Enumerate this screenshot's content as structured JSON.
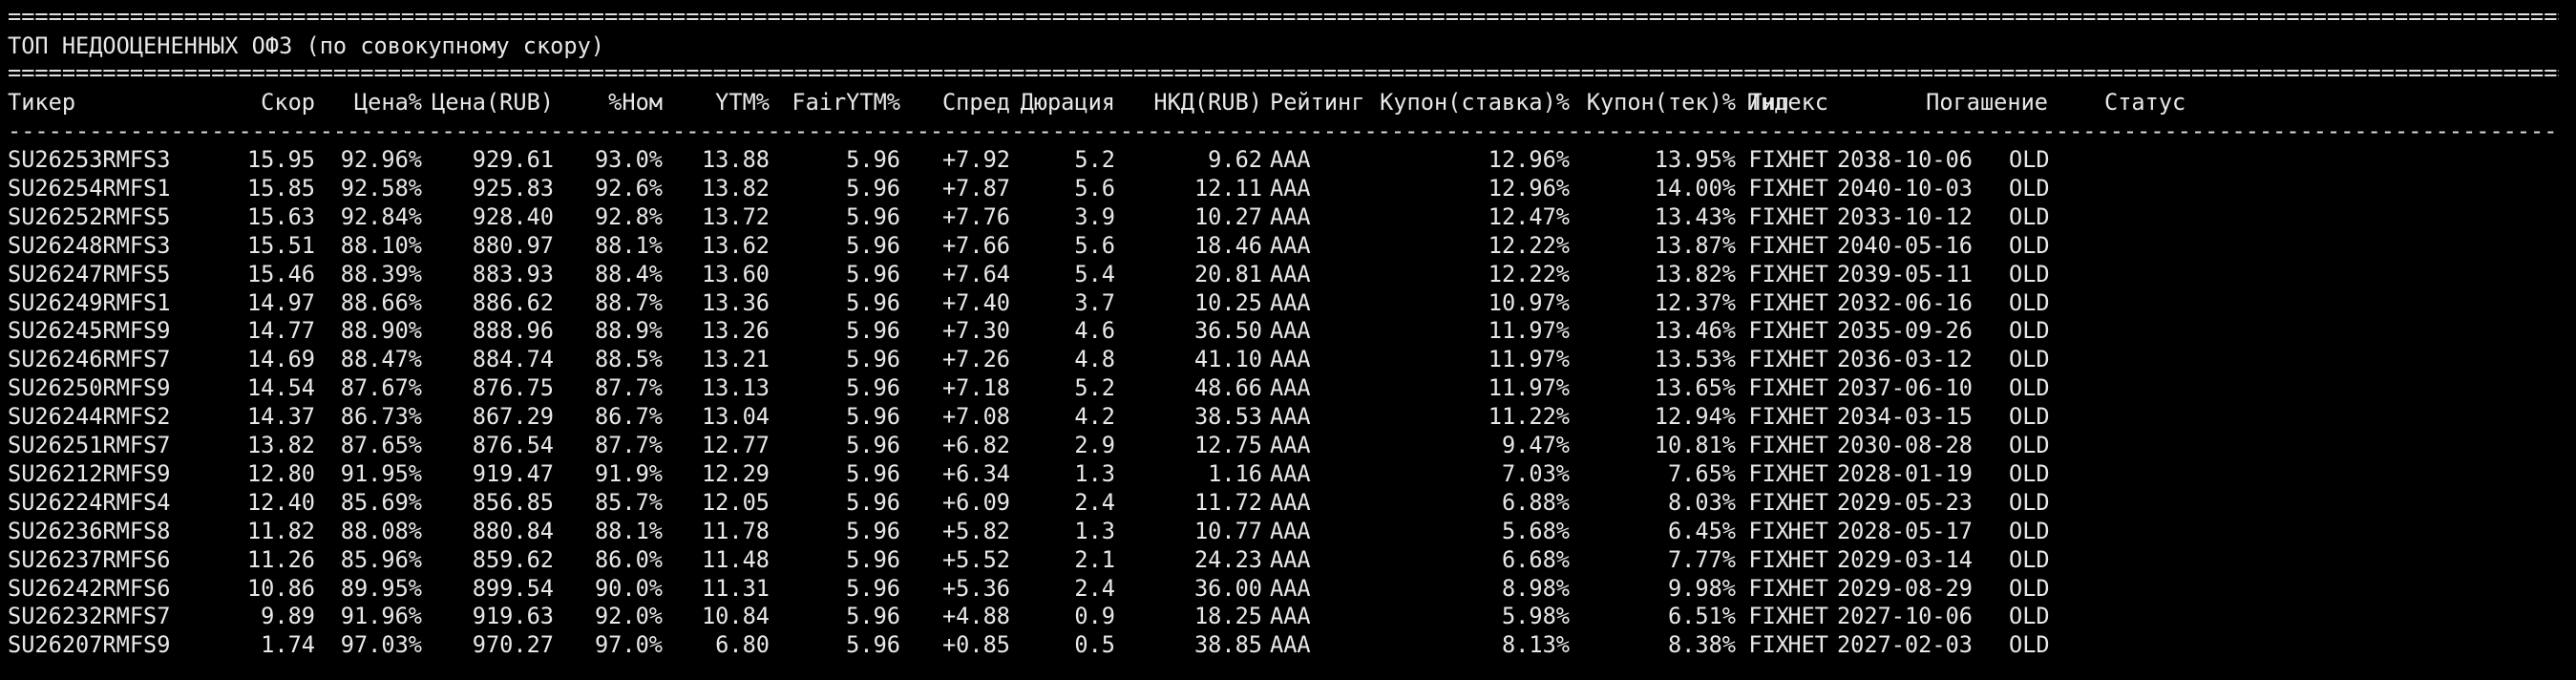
{
  "title": "ТОП НЕДООЦЕНЕННЫХ ОФЗ (по совокупному скору)",
  "rule_double_char": "=",
  "rule_single_char": "-",
  "columns": [
    {
      "key": "ticker",
      "label": "Тикер"
    },
    {
      "key": "score",
      "label": "Скор"
    },
    {
      "key": "price_pct",
      "label": "Цена%"
    },
    {
      "key": "price_rub",
      "label": "Цена(RUB)"
    },
    {
      "key": "pct_nom",
      "label": "%Ном"
    },
    {
      "key": "ytm",
      "label": "YTM%"
    },
    {
      "key": "fair_ytm",
      "label": "FairYTM%"
    },
    {
      "key": "spread",
      "label": "Спред"
    },
    {
      "key": "duration",
      "label": "Дюрация"
    },
    {
      "key": "nkd",
      "label": "НКД(RUB)"
    },
    {
      "key": "rating",
      "label": "Рейтинг"
    },
    {
      "key": "coupon_rate",
      "label": "Купон(ставка)%"
    },
    {
      "key": "coupon_cur",
      "label": "Купон(тек)%"
    },
    {
      "key": "type",
      "label": "Тип"
    },
    {
      "key": "index",
      "label": "Индекс"
    },
    {
      "key": "maturity",
      "label": "Погашение"
    },
    {
      "key": "status",
      "label": "Статус"
    }
  ],
  "rows": [
    {
      "ticker": "SU26253RMFS3",
      "score": "15.95",
      "price_pct": "92.96%",
      "price_rub": "929.61",
      "pct_nom": "93.0%",
      "ytm": "13.88",
      "fair_ytm": "5.96",
      "spread": "+7.92",
      "duration": "5.2",
      "nkd": "9.62",
      "rating": "AAA",
      "coupon_rate": "12.96%",
      "coupon_cur": "13.95%",
      "type": "FIX",
      "index": "НЕТ",
      "maturity": "2038-10-06",
      "status": "OLD"
    },
    {
      "ticker": "SU26254RMFS1",
      "score": "15.85",
      "price_pct": "92.58%",
      "price_rub": "925.83",
      "pct_nom": "92.6%",
      "ytm": "13.82",
      "fair_ytm": "5.96",
      "spread": "+7.87",
      "duration": "5.6",
      "nkd": "12.11",
      "rating": "AAA",
      "coupon_rate": "12.96%",
      "coupon_cur": "14.00%",
      "type": "FIX",
      "index": "НЕТ",
      "maturity": "2040-10-03",
      "status": "OLD"
    },
    {
      "ticker": "SU26252RMFS5",
      "score": "15.63",
      "price_pct": "92.84%",
      "price_rub": "928.40",
      "pct_nom": "92.8%",
      "ytm": "13.72",
      "fair_ytm": "5.96",
      "spread": "+7.76",
      "duration": "3.9",
      "nkd": "10.27",
      "rating": "AAA",
      "coupon_rate": "12.47%",
      "coupon_cur": "13.43%",
      "type": "FIX",
      "index": "НЕТ",
      "maturity": "2033-10-12",
      "status": "OLD"
    },
    {
      "ticker": "SU26248RMFS3",
      "score": "15.51",
      "price_pct": "88.10%",
      "price_rub": "880.97",
      "pct_nom": "88.1%",
      "ytm": "13.62",
      "fair_ytm": "5.96",
      "spread": "+7.66",
      "duration": "5.6",
      "nkd": "18.46",
      "rating": "AAA",
      "coupon_rate": "12.22%",
      "coupon_cur": "13.87%",
      "type": "FIX",
      "index": "НЕТ",
      "maturity": "2040-05-16",
      "status": "OLD"
    },
    {
      "ticker": "SU26247RMFS5",
      "score": "15.46",
      "price_pct": "88.39%",
      "price_rub": "883.93",
      "pct_nom": "88.4%",
      "ytm": "13.60",
      "fair_ytm": "5.96",
      "spread": "+7.64",
      "duration": "5.4",
      "nkd": "20.81",
      "rating": "AAA",
      "coupon_rate": "12.22%",
      "coupon_cur": "13.82%",
      "type": "FIX",
      "index": "НЕТ",
      "maturity": "2039-05-11",
      "status": "OLD"
    },
    {
      "ticker": "SU26249RMFS1",
      "score": "14.97",
      "price_pct": "88.66%",
      "price_rub": "886.62",
      "pct_nom": "88.7%",
      "ytm": "13.36",
      "fair_ytm": "5.96",
      "spread": "+7.40",
      "duration": "3.7",
      "nkd": "10.25",
      "rating": "AAA",
      "coupon_rate": "10.97%",
      "coupon_cur": "12.37%",
      "type": "FIX",
      "index": "НЕТ",
      "maturity": "2032-06-16",
      "status": "OLD"
    },
    {
      "ticker": "SU26245RMFS9",
      "score": "14.77",
      "price_pct": "88.90%",
      "price_rub": "888.96",
      "pct_nom": "88.9%",
      "ytm": "13.26",
      "fair_ytm": "5.96",
      "spread": "+7.30",
      "duration": "4.6",
      "nkd": "36.50",
      "rating": "AAA",
      "coupon_rate": "11.97%",
      "coupon_cur": "13.46%",
      "type": "FIX",
      "index": "НЕТ",
      "maturity": "2035-09-26",
      "status": "OLD"
    },
    {
      "ticker": "SU26246RMFS7",
      "score": "14.69",
      "price_pct": "88.47%",
      "price_rub": "884.74",
      "pct_nom": "88.5%",
      "ytm": "13.21",
      "fair_ytm": "5.96",
      "spread": "+7.26",
      "duration": "4.8",
      "nkd": "41.10",
      "rating": "AAA",
      "coupon_rate": "11.97%",
      "coupon_cur": "13.53%",
      "type": "FIX",
      "index": "НЕТ",
      "maturity": "2036-03-12",
      "status": "OLD"
    },
    {
      "ticker": "SU26250RMFS9",
      "score": "14.54",
      "price_pct": "87.67%",
      "price_rub": "876.75",
      "pct_nom": "87.7%",
      "ytm": "13.13",
      "fair_ytm": "5.96",
      "spread": "+7.18",
      "duration": "5.2",
      "nkd": "48.66",
      "rating": "AAA",
      "coupon_rate": "11.97%",
      "coupon_cur": "13.65%",
      "type": "FIX",
      "index": "НЕТ",
      "maturity": "2037-06-10",
      "status": "OLD"
    },
    {
      "ticker": "SU26244RMFS2",
      "score": "14.37",
      "price_pct": "86.73%",
      "price_rub": "867.29",
      "pct_nom": "86.7%",
      "ytm": "13.04",
      "fair_ytm": "5.96",
      "spread": "+7.08",
      "duration": "4.2",
      "nkd": "38.53",
      "rating": "AAA",
      "coupon_rate": "11.22%",
      "coupon_cur": "12.94%",
      "type": "FIX",
      "index": "НЕТ",
      "maturity": "2034-03-15",
      "status": "OLD"
    },
    {
      "ticker": "SU26251RMFS7",
      "score": "13.82",
      "price_pct": "87.65%",
      "price_rub": "876.54",
      "pct_nom": "87.7%",
      "ytm": "12.77",
      "fair_ytm": "5.96",
      "spread": "+6.82",
      "duration": "2.9",
      "nkd": "12.75",
      "rating": "AAA",
      "coupon_rate": "9.47%",
      "coupon_cur": "10.81%",
      "type": "FIX",
      "index": "НЕТ",
      "maturity": "2030-08-28",
      "status": "OLD"
    },
    {
      "ticker": "SU26212RMFS9",
      "score": "12.80",
      "price_pct": "91.95%",
      "price_rub": "919.47",
      "pct_nom": "91.9%",
      "ytm": "12.29",
      "fair_ytm": "5.96",
      "spread": "+6.34",
      "duration": "1.3",
      "nkd": "1.16",
      "rating": "AAA",
      "coupon_rate": "7.03%",
      "coupon_cur": "7.65%",
      "type": "FIX",
      "index": "НЕТ",
      "maturity": "2028-01-19",
      "status": "OLD"
    },
    {
      "ticker": "SU26224RMFS4",
      "score": "12.40",
      "price_pct": "85.69%",
      "price_rub": "856.85",
      "pct_nom": "85.7%",
      "ytm": "12.05",
      "fair_ytm": "5.96",
      "spread": "+6.09",
      "duration": "2.4",
      "nkd": "11.72",
      "rating": "AAA",
      "coupon_rate": "6.88%",
      "coupon_cur": "8.03%",
      "type": "FIX",
      "index": "НЕТ",
      "maturity": "2029-05-23",
      "status": "OLD"
    },
    {
      "ticker": "SU26236RMFS8",
      "score": "11.82",
      "price_pct": "88.08%",
      "price_rub": "880.84",
      "pct_nom": "88.1%",
      "ytm": "11.78",
      "fair_ytm": "5.96",
      "spread": "+5.82",
      "duration": "1.3",
      "nkd": "10.77",
      "rating": "AAA",
      "coupon_rate": "5.68%",
      "coupon_cur": "6.45%",
      "type": "FIX",
      "index": "НЕТ",
      "maturity": "2028-05-17",
      "status": "OLD"
    },
    {
      "ticker": "SU26237RMFS6",
      "score": "11.26",
      "price_pct": "85.96%",
      "price_rub": "859.62",
      "pct_nom": "86.0%",
      "ytm": "11.48",
      "fair_ytm": "5.96",
      "spread": "+5.52",
      "duration": "2.1",
      "nkd": "24.23",
      "rating": "AAA",
      "coupon_rate": "6.68%",
      "coupon_cur": "7.77%",
      "type": "FIX",
      "index": "НЕТ",
      "maturity": "2029-03-14",
      "status": "OLD"
    },
    {
      "ticker": "SU26242RMFS6",
      "score": "10.86",
      "price_pct": "89.95%",
      "price_rub": "899.54",
      "pct_nom": "90.0%",
      "ytm": "11.31",
      "fair_ytm": "5.96",
      "spread": "+5.36",
      "duration": "2.4",
      "nkd": "36.00",
      "rating": "AAA",
      "coupon_rate": "8.98%",
      "coupon_cur": "9.98%",
      "type": "FIX",
      "index": "НЕТ",
      "maturity": "2029-08-29",
      "status": "OLD"
    },
    {
      "ticker": "SU26232RMFS7",
      "score": "9.89",
      "price_pct": "91.96%",
      "price_rub": "919.63",
      "pct_nom": "92.0%",
      "ytm": "10.84",
      "fair_ytm": "5.96",
      "spread": "+4.88",
      "duration": "0.9",
      "nkd": "18.25",
      "rating": "AAA",
      "coupon_rate": "5.98%",
      "coupon_cur": "6.51%",
      "type": "FIX",
      "index": "НЕТ",
      "maturity": "2027-10-06",
      "status": "OLD"
    },
    {
      "ticker": "SU26207RMFS9",
      "score": "1.74",
      "price_pct": "97.03%",
      "price_rub": "970.27",
      "pct_nom": "97.0%",
      "ytm": "6.80",
      "fair_ytm": "5.96",
      "spread": "+0.85",
      "duration": "0.5",
      "nkd": "38.85",
      "rating": "AAA",
      "coupon_rate": "8.13%",
      "coupon_cur": "8.38%",
      "type": "FIX",
      "index": "НЕТ",
      "maturity": "2027-02-03",
      "status": "OLD"
    }
  ],
  "colors": {
    "background": "#000000",
    "text": "#e8e8e8"
  }
}
